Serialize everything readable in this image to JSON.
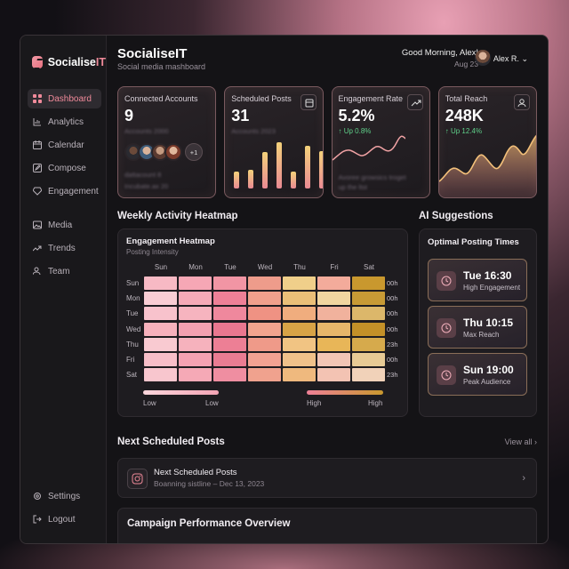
{
  "brand": {
    "name_main": "Socialise",
    "name_accent": "IT"
  },
  "sidebar": {
    "items": [
      {
        "label": "Dashboard",
        "icon": "grid-icon",
        "active": true
      },
      {
        "label": "Analytics",
        "icon": "bar-chart-icon"
      },
      {
        "label": "Calendar",
        "icon": "calendar-icon"
      },
      {
        "label": "Compose",
        "icon": "pencil-icon"
      },
      {
        "label": "Engagement",
        "icon": "diamond-icon"
      }
    ],
    "items2": [
      {
        "label": "Media",
        "icon": "image-icon"
      },
      {
        "label": "Trends",
        "icon": "trend-up-icon"
      },
      {
        "label": "Team",
        "icon": "users-icon"
      }
    ],
    "bottom": [
      {
        "label": "Settings",
        "icon": "gear-icon"
      },
      {
        "label": "Logout",
        "icon": "logout-icon"
      }
    ]
  },
  "header": {
    "title": "SocialiseIT",
    "subtitle": "Social media mashboard",
    "greeting": "Good Morning, Alex!",
    "date": "Aug 23",
    "user": "Alex R."
  },
  "cards": {
    "connected": {
      "label": "Connected Accounts",
      "value": "9",
      "blur1": "Accounts 2000",
      "blur2": "dattacount 8",
      "blur3": "Incubate.ax 20",
      "more": "+1"
    },
    "scheduled": {
      "label": "Scheduled Posts",
      "value": "31",
      "blur1": "Accounts 2023",
      "bars": [
        0.32,
        0.35,
        0.68,
        0.86,
        0.32,
        0.8,
        0.7
      ]
    },
    "engagement": {
      "label": "Engagement Rate",
      "value": "5.2%",
      "change": "↑ Up 0.8%",
      "blur1": "Avoree growsics troget",
      "blur2": "up the ltst"
    },
    "reach": {
      "label": "Total Reach",
      "value": "248K",
      "change": "↑ Up 12.4%"
    }
  },
  "heatmap": {
    "section": "Weekly Activity Heatmap",
    "title": "Engagement Heatmap",
    "subtitle": "Posting Intensity",
    "days": [
      "Sun",
      "Mon",
      "Tue",
      "Wed",
      "Thu",
      "Fri",
      "Sat"
    ],
    "rows": [
      "Sun",
      "Mon",
      "Tue",
      "Wed",
      "Thu",
      "Fri",
      "Sat"
    ],
    "times": [
      "00h",
      "00h",
      "00h",
      "00h",
      "23h",
      "00h",
      "23h"
    ],
    "colors": [
      [
        "#f7b9c4",
        "#f6a7b5",
        "#f195a4",
        "#ee9c8b",
        "#f0cf8a",
        "#f3ab9b",
        "#c9982e"
      ],
      [
        "#f9cdd4",
        "#f5aab7",
        "#ee8097",
        "#f0a08c",
        "#eabf78",
        "#f1d6a0",
        "#c79a35"
      ],
      [
        "#f8c2cc",
        "#f6b4bf",
        "#ef889d",
        "#ef9283",
        "#f0ad7e",
        "#f1b29d",
        "#dcb76a"
      ],
      [
        "#f7b1bc",
        "#f3a0b0",
        "#e9778f",
        "#f1a48e",
        "#d7a346",
        "#e6b66a",
        "#c39028"
      ],
      [
        "#f9cad1",
        "#f6b2bd",
        "#ed7f95",
        "#ef9a89",
        "#f1c483",
        "#e8b658",
        "#d6aa4c"
      ],
      [
        "#f7bec8",
        "#f4a2b2",
        "#e97c92",
        "#f2a292",
        "#f0c18a",
        "#f2c5b5",
        "#e7ca95"
      ],
      [
        "#f8c6ce",
        "#f5a9b6",
        "#ef8ea1",
        "#f0a28e",
        "#efb97e",
        "#f3c3b3",
        "#f1d2b9"
      ]
    ],
    "legend": {
      "low1": "Low",
      "low2": "Low",
      "high1": "High",
      "high2": "High"
    }
  },
  "ai": {
    "section": "AI Suggestions",
    "title": "Optimal Posting Times",
    "slots": [
      {
        "time": "Tue 16:30",
        "label": "High Engagement"
      },
      {
        "time": "Thu 10:15",
        "label": "Max Reach"
      },
      {
        "time": "Sun 19:00",
        "label": "Peak Audience"
      }
    ]
  },
  "next": {
    "section": "Next Scheduled Posts",
    "view_all": "View all",
    "title": "Next Scheduled Posts",
    "subtitle": "Boanning sistline – Dec 13, 2023"
  },
  "campaign": {
    "title": "Campaign Performance Overview"
  },
  "colors": {
    "accent": "#f08a9a",
    "positive": "#5fd08a",
    "bg": "#141316"
  }
}
